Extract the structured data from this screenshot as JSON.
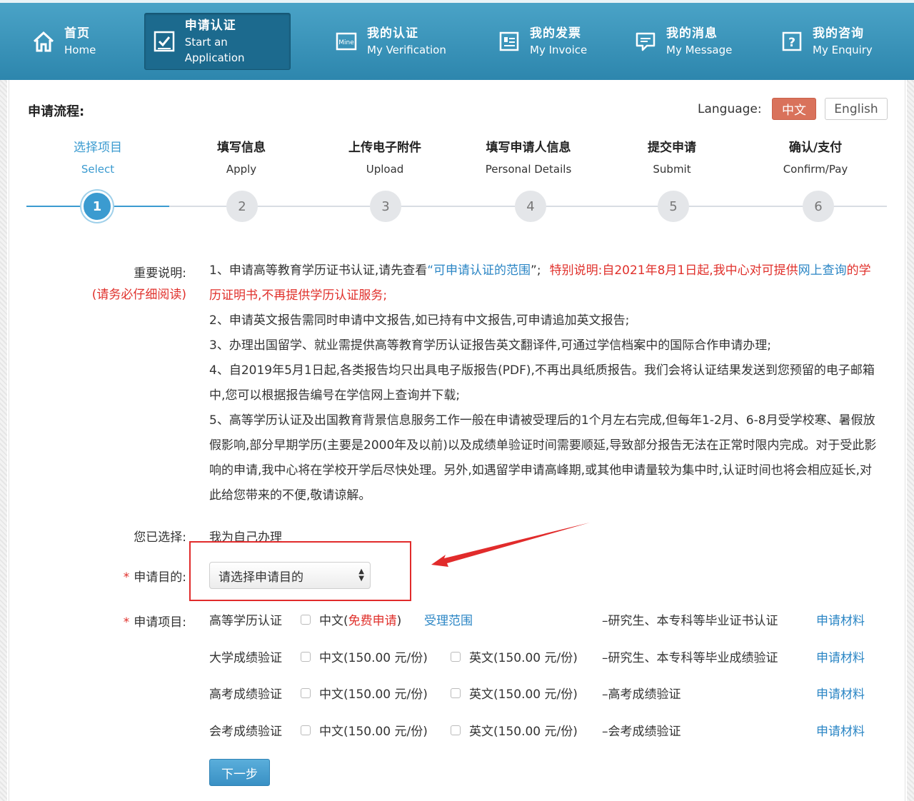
{
  "nav": {
    "items": [
      {
        "cn": "首页",
        "en": "Home",
        "icon": "home-icon"
      },
      {
        "cn": "申请认证",
        "en": "Start an Application",
        "icon": "checkbox-icon"
      },
      {
        "cn": "我的认证",
        "en": "My Verification",
        "icon": "mine-icon"
      },
      {
        "cn": "我的发票",
        "en": "My Invoice",
        "icon": "invoice-icon"
      },
      {
        "cn": "我的消息",
        "en": "My Message",
        "icon": "message-icon"
      },
      {
        "cn": "我的咨询",
        "en": "My Enquiry",
        "icon": "question-icon"
      }
    ],
    "active_index": 1,
    "mine_icon_text": "Mine",
    "question_icon_text": "?"
  },
  "flow": {
    "title": "申请流程:"
  },
  "language": {
    "label": "Language:",
    "cn": "中文",
    "en": "English",
    "active": "中文"
  },
  "steps": [
    {
      "cn": "选择项目",
      "en": "Select",
      "num": "1"
    },
    {
      "cn": "填写信息",
      "en": "Apply",
      "num": "2"
    },
    {
      "cn": "上传电子附件",
      "en": "Upload",
      "num": "3"
    },
    {
      "cn": "填写申请人信息",
      "en": "Personal Details",
      "num": "4"
    },
    {
      "cn": "提交申请",
      "en": "Submit",
      "num": "5"
    },
    {
      "cn": "确认/支付",
      "en": "Confirm/Pay",
      "num": "6"
    }
  ],
  "notice": {
    "label": "重要说明:",
    "label_warn": "(请务必仔细阅读)",
    "p1_prefix": "1、申请高等教育学历证书认证,请先查看",
    "p1_link_open": "“",
    "p1_link": "可申请认证的范围",
    "p1_link_close": "”;",
    "p1_special": "特别说明:自2021年8月1日起,我中心对可提供",
    "p1_link2": "网上查询",
    "p1_special_end": "的学历证明书,不再提供学历认证服务;",
    "p2": "2、申请英文报告需同时申请中文报告,如已持有中文报告,可申请追加英文报告;",
    "p3": "3、办理出国留学、就业需提供高等教育学历认证报告英文翻译件,可通过学信档案中的国际合作申请办理;",
    "p4": "4、自2019年5月1日起,各类报告均只出具电子版报告(PDF),不再出具纸质报告。我们会将认证结果发送到您预留的电子邮箱中,您可以根据报告编号在学信网上查询并下载;",
    "p5": "5、高等学历认证及出国教育背景信息服务工作一般在申请被受理后的1个月左右完成,但每年1-2月、6-8月受学校寒、暑假放假影响,部分早期学历(主要是2000年及以前)以及成绩单验证时间需要顺延,导致部分报告无法在正常时限内完成。对于受此影响的申请,我中心将在学校开学后尽快处理。另外,如遇留学申请高峰期,或其他申请量较为集中时,认证时间也将会相应延长,对此给您带来的不便,敬请谅解。"
  },
  "chosen": {
    "label": "您已选择:",
    "value": "我为自己办理"
  },
  "purpose": {
    "required_mark": "*",
    "label": "申请目的:",
    "selected": "请选择申请目的"
  },
  "projects": {
    "required_mark": "*",
    "label": "申请项目:",
    "rows": [
      {
        "name": "高等学历认证",
        "cn_prefix": "中文(",
        "cn_free": "免费申请",
        "cn_suffix": ")",
        "range_link": "受理范围",
        "desc": "–研究生、本专科等毕业证书认证",
        "materials": "申请材料"
      },
      {
        "name": "大学成绩验证",
        "cn": "中文(150.00 元/份)",
        "en": "英文(150.00 元/份)",
        "desc": "–研究生、本专科等毕业成绩验证",
        "materials": "申请材料"
      },
      {
        "name": "高考成绩验证",
        "cn": "中文(150.00 元/份)",
        "en": "英文(150.00 元/份)",
        "desc": "–高考成绩验证",
        "materials": "申请材料"
      },
      {
        "name": "会考成绩验证",
        "cn": "中文(150.00 元/份)",
        "en": "英文(150.00 元/份)",
        "desc": "–会考成绩验证",
        "materials": "申请材料"
      }
    ]
  },
  "next_button": "下一步",
  "colors": {
    "nav_bg": "#3a95bd",
    "nav_active": "#1c6a8e",
    "accent_blue": "#3b9bd0",
    "link_blue": "#2b86c5",
    "warn_red": "#e0302b",
    "lang_active": "#d9725b",
    "annotation_red": "#e12b2b"
  }
}
